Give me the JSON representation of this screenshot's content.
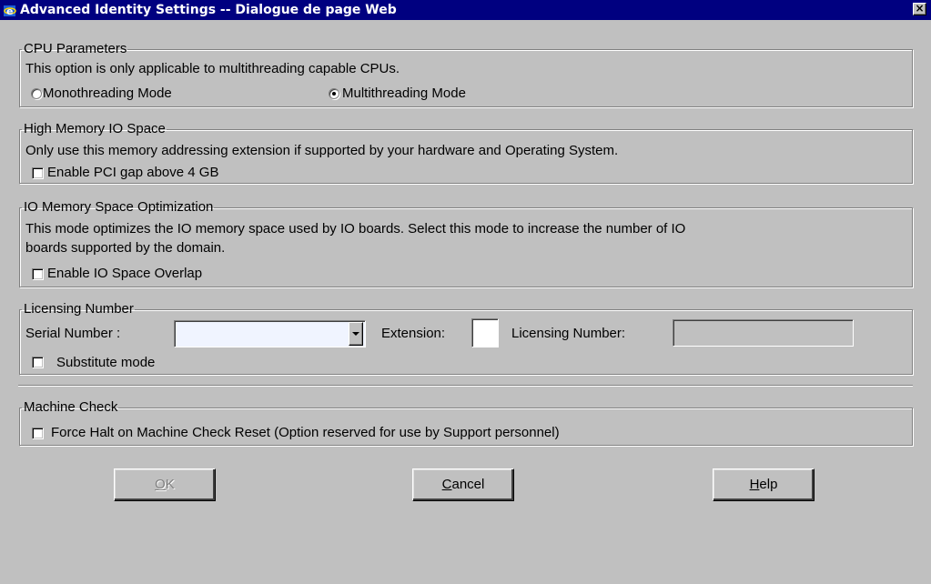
{
  "window": {
    "title": "Advanced Identity Settings -- Dialogue de page Web",
    "close_glyph": "×",
    "title_bar_color": "#000080",
    "background_color": "#c0c0c0"
  },
  "cpu": {
    "legend": "CPU Parameters",
    "description": "This option is only applicable to multithreading capable CPUs.",
    "options": [
      {
        "label": "Monothreading Mode",
        "checked": false
      },
      {
        "label": "Multithreading Mode",
        "checked": true
      }
    ]
  },
  "high_memory": {
    "legend": "High Memory IO Space",
    "description": "Only use this memory addressing extension if supported by your hardware and Operating System.",
    "checkbox_label": "Enable PCI gap above 4 GB",
    "checked": false
  },
  "io_optimization": {
    "legend": "IO Memory Space Optimization",
    "description_line1": "This mode optimizes the IO memory space used by IO boards. Select this mode to increase the number of IO",
    "description_line2": "boards supported by the domain.",
    "checkbox_label": "Enable IO Space Overlap",
    "checked": false
  },
  "licensing": {
    "legend": "Licensing Number",
    "serial_label": "Serial Number :",
    "serial_value": "",
    "extension_label": "Extension:",
    "extension_value": "",
    "licensing_label": "Licensing Number:",
    "licensing_value": "",
    "substitute_label": "Substitute mode",
    "substitute_checked": false
  },
  "machine_check": {
    "legend": "Machine Check",
    "checkbox_label": "Force Halt on Machine Check Reset (Option reserved for use by Support personnel)",
    "checked": false
  },
  "buttons": {
    "ok": {
      "first": "O",
      "rest": "K",
      "disabled": true
    },
    "cancel": {
      "first": "C",
      "rest": "ancel"
    },
    "help": {
      "first": "H",
      "rest": "elp"
    }
  },
  "icons": [
    "ie-app-icon",
    "close-icon",
    "dropdown-arrow-icon"
  ]
}
